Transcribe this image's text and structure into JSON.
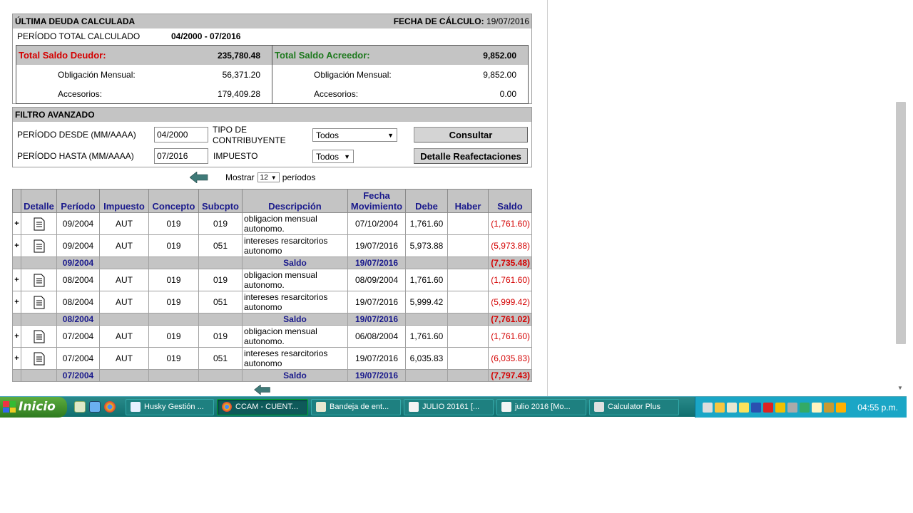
{
  "ultima": {
    "title": "ÚLTIMA DEUDA CALCULADA",
    "fecha_label": "FECHA DE CÁLCULO:",
    "fecha_value": "19/07/2016",
    "periodo_label": "PERÍODO TOTAL CALCULADO",
    "periodo_value": "04/2000 - 07/2016",
    "deudor": {
      "label": "Total Saldo Deudor:",
      "total": "235,780.48",
      "oblig_label": "Obligación Mensual:",
      "oblig_value": "56,371.20",
      "acc_label": "Accesorios:",
      "acc_value": "179,409.28"
    },
    "acreedor": {
      "label": "Total Saldo Acreedor:",
      "total": "9,852.00",
      "oblig_label": "Obligación Mensual:",
      "oblig_value": "9,852.00",
      "acc_label": "Accesorios:",
      "acc_value": "0.00"
    }
  },
  "filtro": {
    "title": "FILTRO AVANZADO",
    "desde_label": "PERÍODO DESDE (MM/AAAA)",
    "desde_value": "04/2000",
    "hasta_label": "PERÍODO HASTA (MM/AAAA)",
    "hasta_value": "07/2016",
    "tipo_label_1": "TIPO DE",
    "tipo_label_2": "CONTRIBUYENTE",
    "tipo_value": "Todos",
    "impuesto_label": "IMPUESTO",
    "impuesto_value": "Todos",
    "consultar": "Consultar",
    "detalle_reaf": "Detalle Reafectaciones"
  },
  "paginacion": {
    "mostrar": "Mostrar",
    "cantidad": "12",
    "periodos": "períodos"
  },
  "tabla": {
    "headers": {
      "detalle": "Detalle",
      "periodo": "Período",
      "impuesto": "Impuesto",
      "concepto": "Concepto",
      "subcpto": "Subcpto",
      "descripcion": "Descripción",
      "fecha_1": "Fecha",
      "fecha_2": "Movimiento",
      "debe": "Debe",
      "haber": "Haber",
      "saldo": "Saldo"
    },
    "rows": [
      {
        "type": "item",
        "plus": "+",
        "periodo": "09/2004",
        "impuesto": "AUT",
        "concepto": "019",
        "subcpto": "019",
        "desc": "obligacion mensual autonomo.",
        "fecha": "07/10/2004",
        "debe": "1,761.60",
        "haber": "",
        "saldo": "(1,761.60)"
      },
      {
        "type": "item",
        "plus": "+",
        "periodo": "09/2004",
        "impuesto": "AUT",
        "concepto": "019",
        "subcpto": "051",
        "desc": "intereses resarcitorios autonomo",
        "fecha": "19/07/2016",
        "debe": "5,973.88",
        "haber": "",
        "saldo": "(5,973.88)"
      },
      {
        "type": "sum",
        "periodo": "09/2004",
        "desc": "Saldo",
        "fecha": "19/07/2016",
        "saldo": "(7,735.48)"
      },
      {
        "type": "item",
        "plus": "+",
        "periodo": "08/2004",
        "impuesto": "AUT",
        "concepto": "019",
        "subcpto": "019",
        "desc": "obligacion mensual autonomo.",
        "fecha": "08/09/2004",
        "debe": "1,761.60",
        "haber": "",
        "saldo": "(1,761.60)"
      },
      {
        "type": "item",
        "plus": "+",
        "periodo": "08/2004",
        "impuesto": "AUT",
        "concepto": "019",
        "subcpto": "051",
        "desc": "intereses resarcitorios autonomo",
        "fecha": "19/07/2016",
        "debe": "5,999.42",
        "haber": "",
        "saldo": "(5,999.42)"
      },
      {
        "type": "sum",
        "periodo": "08/2004",
        "desc": "Saldo",
        "fecha": "19/07/2016",
        "saldo": "(7,761.02)"
      },
      {
        "type": "item",
        "plus": "+",
        "periodo": "07/2004",
        "impuesto": "AUT",
        "concepto": "019",
        "subcpto": "019",
        "desc": "obligacion mensual autonomo.",
        "fecha": "06/08/2004",
        "debe": "1,761.60",
        "haber": "",
        "saldo": "(1,761.60)"
      },
      {
        "type": "item",
        "plus": "+",
        "periodo": "07/2004",
        "impuesto": "AUT",
        "concepto": "019",
        "subcpto": "051",
        "desc": "intereses resarcitorios autonomo",
        "fecha": "19/07/2016",
        "debe": "6,035.83",
        "haber": "",
        "saldo": "(6,035.83)"
      },
      {
        "type": "sum",
        "periodo": "07/2004",
        "desc": "Saldo",
        "fecha": "19/07/2016",
        "saldo": "(7,797.43)"
      }
    ]
  },
  "taskbar": {
    "start": "Inicio",
    "tasks": [
      {
        "label": "Husky Gestión ...",
        "icon": "husky-app-icon",
        "color": "#e8f0ff"
      },
      {
        "label": "CCAM - CUENT...",
        "icon": "chrome-icon",
        "color": "#f2b51c"
      },
      {
        "label": "Bandeja de ent...",
        "icon": "mail-icon",
        "color": "#e8e8d0"
      },
      {
        "label": "JULIO 20161  [...",
        "icon": "spreadsheet-icon",
        "color": "#f4f4f4"
      },
      {
        "label": "julio 2016  [Mo...",
        "icon": "spreadsheet-icon",
        "color": "#f4f4f4"
      },
      {
        "label": "Calculator Plus",
        "icon": "calculator-icon",
        "color": "#e0e0e0"
      }
    ],
    "clock": "04:55 p.m."
  }
}
